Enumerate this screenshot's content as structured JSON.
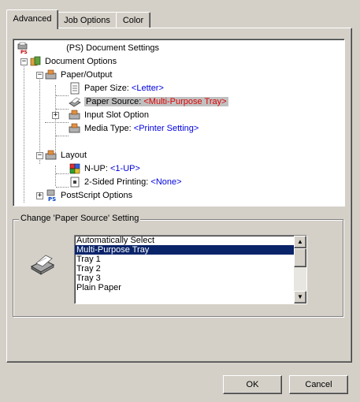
{
  "tabs": [
    {
      "label": "Advanced"
    },
    {
      "label": "Job Options"
    },
    {
      "label": "Color"
    }
  ],
  "tree": {
    "root": "(PS) Document Settings",
    "document_options": "Document Options",
    "paper_output": "Paper/Output",
    "paper_size_label": "Paper Size: ",
    "paper_size_value": "<Letter>",
    "paper_source_label": "Paper Source: ",
    "paper_source_value": "<Multi-Purpose Tray>",
    "input_slot": "Input Slot Option",
    "media_type_label": "Media Type: ",
    "media_type_value": "<Printer Setting>",
    "layout": "Layout",
    "nup_label": "N-UP: ",
    "nup_value": "<1-UP>",
    "two_sided_label": "2-Sided Printing: ",
    "two_sided_value": "<None>",
    "postscript_options": "PostScript Options"
  },
  "setting_group": {
    "title": "Change 'Paper Source' Setting",
    "options": [
      "Automatically Select",
      "Multi-Purpose Tray",
      "Tray 1",
      "Tray 2",
      "Tray 3",
      "Plain Paper"
    ],
    "selected": "Multi-Purpose Tray"
  },
  "buttons": {
    "ok": "OK",
    "cancel": "Cancel"
  },
  "colors": {
    "selection": "#0a246a",
    "value_blue": "#0000e0",
    "value_red": "#e00000"
  }
}
